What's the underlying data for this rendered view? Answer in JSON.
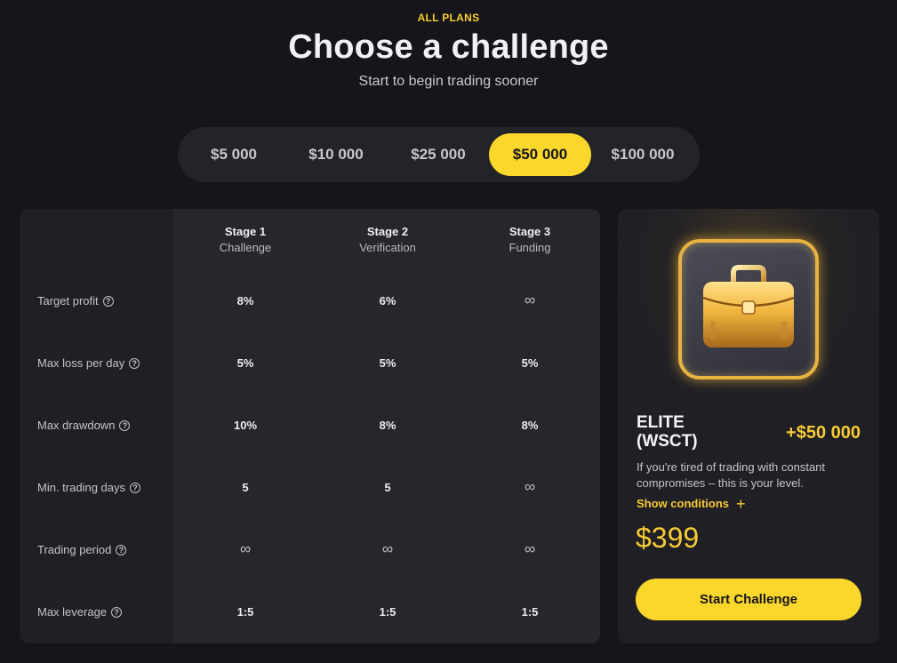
{
  "header": {
    "eyebrow": "ALL PLANS",
    "title": "Choose a challenge",
    "subtitle": "Start to begin trading sooner"
  },
  "plan_tabs": [
    {
      "label": "$5 000",
      "active": false
    },
    {
      "label": "$10 000",
      "active": false
    },
    {
      "label": "$25 000",
      "active": false
    },
    {
      "label": "$50 000",
      "active": true
    },
    {
      "label": "$100 000",
      "active": false
    }
  ],
  "table": {
    "stages": [
      {
        "stage": "Stage 1",
        "name": "Challenge"
      },
      {
        "stage": "Stage 2",
        "name": "Verification"
      },
      {
        "stage": "Stage 3",
        "name": "Funding"
      }
    ],
    "rows": [
      {
        "label": "Target profit",
        "values": [
          "8%",
          "6%",
          "∞"
        ]
      },
      {
        "label": "Max loss per day",
        "values": [
          "5%",
          "5%",
          "5%"
        ]
      },
      {
        "label": "Max drawdown",
        "values": [
          "10%",
          "8%",
          "8%"
        ]
      },
      {
        "label": "Min. trading days",
        "values": [
          "5",
          "5",
          "∞"
        ]
      },
      {
        "label": "Trading period",
        "values": [
          "∞",
          "∞",
          "∞"
        ]
      },
      {
        "label": "Max leverage",
        "values": [
          "1:5",
          "1:5",
          "1:5"
        ]
      }
    ],
    "help_icon": "?"
  },
  "card": {
    "icon": "briefcase-icon",
    "title_line1": "ELITE",
    "title_line2": "(WSCT)",
    "bonus": "+$50 000",
    "description": "If you're tired of trading with constant compromises – this is your level.",
    "show_conditions": "Show conditions",
    "plus_glyph": "+",
    "price": "$399",
    "cta": "Start Challenge"
  },
  "colors": {
    "accent": "#fbd72b",
    "gold_text": "#f6cb34",
    "background": "#15151b",
    "panel": "#1f1f25"
  }
}
